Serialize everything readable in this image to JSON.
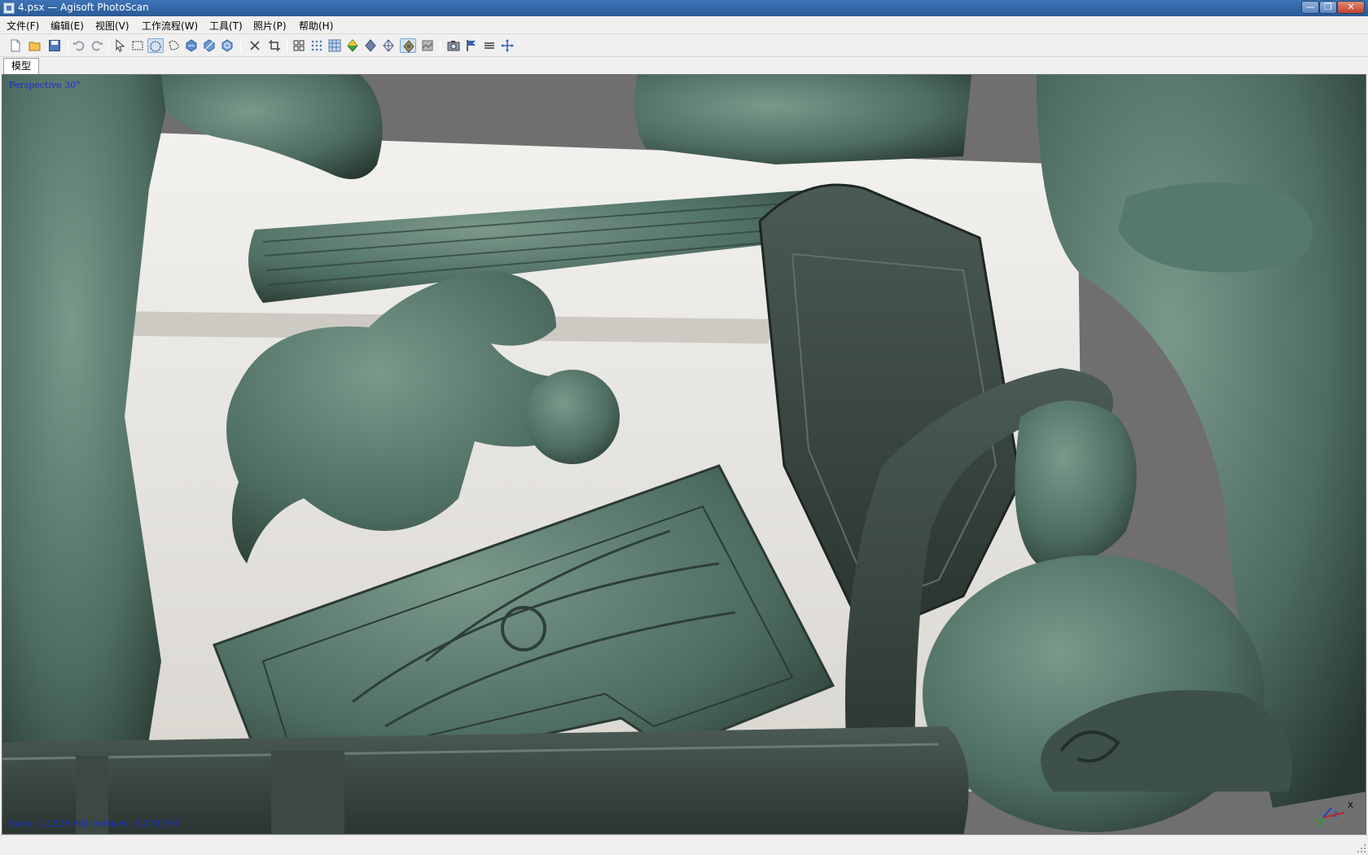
{
  "window": {
    "title": "4.psx — Agisoft PhotoScan",
    "controls": {
      "minimize": "—",
      "restore": "❐",
      "close": "✕"
    }
  },
  "menu": [
    {
      "label": "文件(F)"
    },
    {
      "label": "编辑(E)"
    },
    {
      "label": "视图(V)"
    },
    {
      "label": "工作流程(W)"
    },
    {
      "label": "工具(T)"
    },
    {
      "label": "照片(P)"
    },
    {
      "label": "帮助(H)"
    }
  ],
  "toolbar": {
    "icons": [
      "new-project-icon",
      "open-project-icon",
      "save-project-icon",
      "undo-icon",
      "redo-icon",
      "navigation-icon",
      "rectangle-selection-icon",
      "circle-selection-icon",
      "free-form-selection-icon",
      "rotate-object-icon",
      "resize-region-icon",
      "rotate-region-icon",
      "delete-selection-icon",
      "crop-selection-icon",
      "show-cameras-grid-icon",
      "show-points-icon",
      "show-dense-cloud-icon",
      "shaded-model-icon",
      "solid-model-icon",
      "wireframe-model-icon",
      "textured-model-icon",
      "show-dem-icon",
      "show-cameras-icon",
      "show-markers-icon",
      "show-shapes-icon",
      "reset-view-icon"
    ],
    "active_icons": [
      "circle-selection-icon",
      "textured-model-icon"
    ]
  },
  "tabs": [
    {
      "label": "模型",
      "active": true
    }
  ],
  "viewport": {
    "projection_label": "Perspective 30°",
    "stats_label": "faces: 12,529,961 vertices: 6,279,560",
    "axes": {
      "x": "X",
      "y": "Y",
      "z": "Z"
    },
    "colors": {
      "background": "#6f6f6f",
      "overlay_text": "#1b2bd6",
      "bronze": "#4e6d62",
      "stone": "#e9e7e2"
    }
  }
}
